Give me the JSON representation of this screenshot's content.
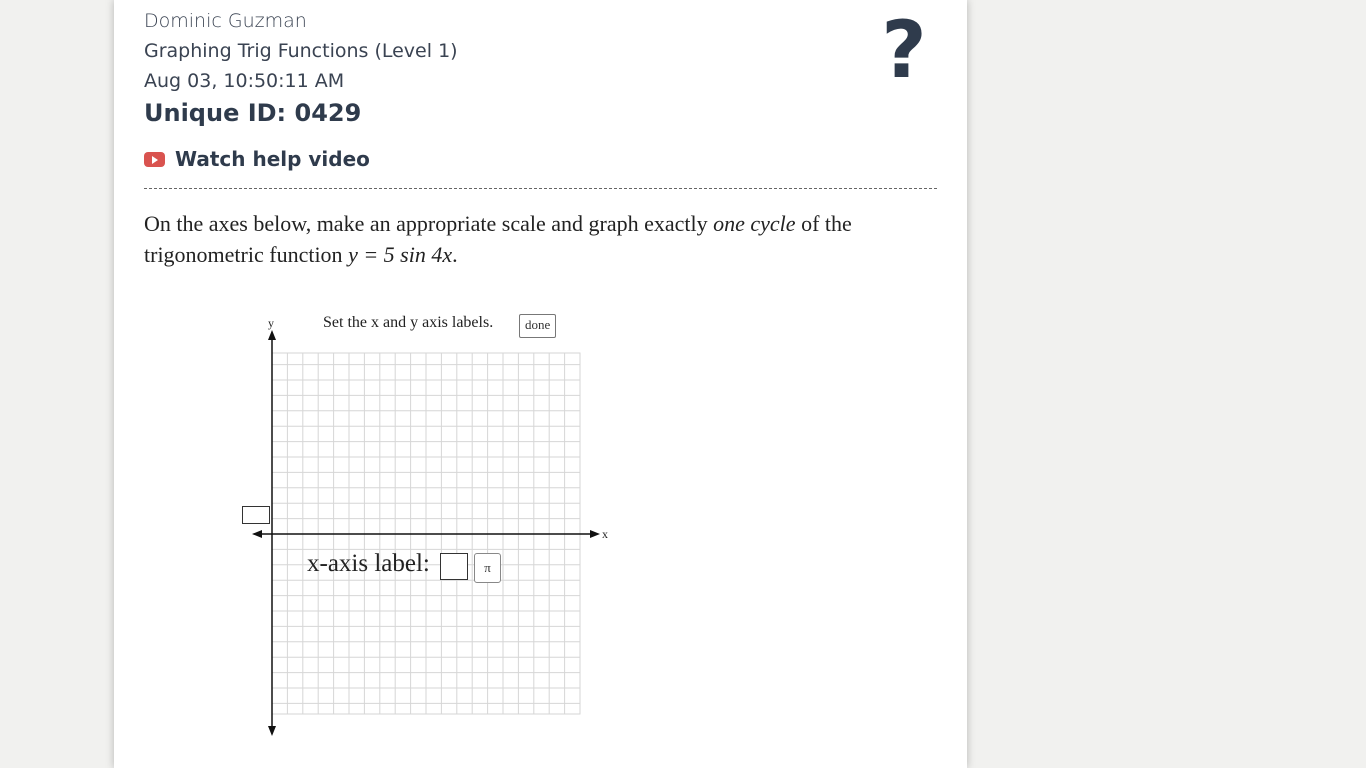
{
  "header": {
    "student_name": "Dominic Guzman",
    "assignment": "Graphing Trig Functions (Level 1)",
    "timestamp": "Aug 03, 10:50:11 AM",
    "unique_id": "Unique ID: 0429",
    "help_symbol": "?"
  },
  "help_video": {
    "icon": "youtube-play-icon",
    "label": "Watch help video",
    "icon_color": "#d9534f"
  },
  "question": {
    "text_before": "On the axes below, make an appropriate scale and graph exactly ",
    "emphasis": "one cycle",
    "text_middle": " of the trigonometric function ",
    "math": "y = 5 sin 4x",
    "text_end": "."
  },
  "graph": {
    "instruction": "Set the x and y axis labels.",
    "done_label": "done",
    "y_axis_name": "y",
    "x_axis_name": "x",
    "x_axis_label_prompt": "x-axis label:",
    "pi_button": "π",
    "y_axis_label_value": "",
    "x_axis_label_value": ""
  },
  "colors": {
    "text_dark": "#2f3b4c",
    "grid": "#d6d6d6",
    "background": "#f1f1ef"
  }
}
